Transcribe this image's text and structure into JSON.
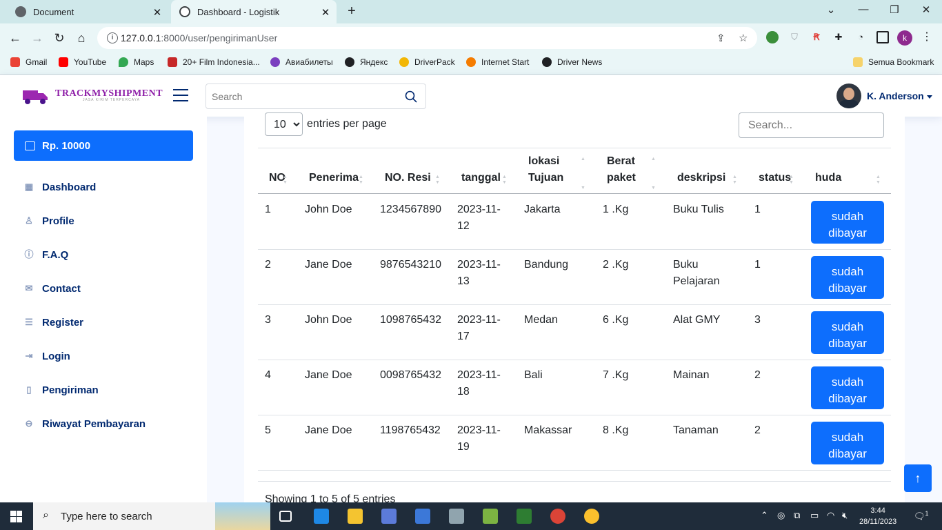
{
  "browser": {
    "tabs": [
      {
        "title": "Document"
      },
      {
        "title": "Dashboard - Logistik"
      }
    ],
    "url_host": "127.0.0.1",
    "url_path": ":8000/user/pengirimanUser",
    "bookmarks": [
      "Gmail",
      "YouTube",
      "Maps",
      "20+ Film Indonesia...",
      "Авиабилеты",
      "Яндекс",
      "DriverPack",
      "Internet Start",
      "Driver News"
    ],
    "bookmarks_folder": "Semua Bookmark",
    "profile_initial": "k"
  },
  "header": {
    "logo_text": "TRACKMYSHIPMENT",
    "logo_sub": "JASA KIRIM TERPERCAYA",
    "search_placeholder": "Search",
    "user_name": "K. Anderson"
  },
  "sidebar": {
    "balance": "Rp. 10000",
    "items": [
      {
        "label": "Dashboard",
        "icon": "grid-icon"
      },
      {
        "label": "Profile",
        "icon": "person-icon"
      },
      {
        "label": "F.A.Q",
        "icon": "question-circle-icon"
      },
      {
        "label": "Contact",
        "icon": "envelope-icon"
      },
      {
        "label": "Register",
        "icon": "card-list-icon"
      },
      {
        "label": "Login",
        "icon": "box-arrow-in-right-icon"
      },
      {
        "label": "Pengiriman",
        "icon": "file-icon"
      },
      {
        "label": "Riwayat Pembayaran",
        "icon": "dash-circle-icon"
      }
    ]
  },
  "table": {
    "per_page_value": "10",
    "per_page_label": "entries per page",
    "search_placeholder": "Search...",
    "headers": [
      "NO",
      "Penerima",
      "NO. Resi",
      "tanggal",
      "lokasi Tujuan",
      "Berat paket",
      "deskripsi",
      "status",
      "huda"
    ],
    "rows": [
      {
        "no": "1",
        "penerima": "John Doe",
        "resi": "1234567890",
        "tanggal": "2023-11-12",
        "lokasi": "Jakarta",
        "berat": "1 .Kg",
        "deskripsi": "Buku Tulis",
        "status": "1",
        "action": "sudah dibayar"
      },
      {
        "no": "2",
        "penerima": "Jane Doe",
        "resi": "9876543210",
        "tanggal": "2023-11-13",
        "lokasi": "Bandung",
        "berat": "2 .Kg",
        "deskripsi": "Buku Pelajaran",
        "status": "1",
        "action": "sudah dibayar"
      },
      {
        "no": "3",
        "penerima": "John Doe",
        "resi": "1098765432",
        "tanggal": "2023-11-17",
        "lokasi": "Medan",
        "berat": "6 .Kg",
        "deskripsi": "Alat GMY",
        "status": "3",
        "action": "sudah dibayar"
      },
      {
        "no": "4",
        "penerima": "Jane Doe",
        "resi": "0098765432",
        "tanggal": "2023-11-18",
        "lokasi": "Bali",
        "berat": "7 .Kg",
        "deskripsi": "Mainan",
        "status": "2",
        "action": "sudah dibayar"
      },
      {
        "no": "5",
        "penerima": "Jane Doe",
        "resi": "1198765432",
        "tanggal": "2023-11-19",
        "lokasi": "Makassar",
        "berat": "8 .Kg",
        "deskripsi": "Tanaman",
        "status": "2",
        "action": "sudah dibayar"
      }
    ],
    "footer": "Showing 1 to 5 of 5 entries"
  },
  "taskbar": {
    "search_label": "Type here to search",
    "time": "3:44",
    "date": "28/11/2023",
    "notification_count": "1"
  },
  "colors": {
    "primary": "#0d6efd",
    "nav_text": "#012970",
    "logo": "#8e1fa8"
  }
}
